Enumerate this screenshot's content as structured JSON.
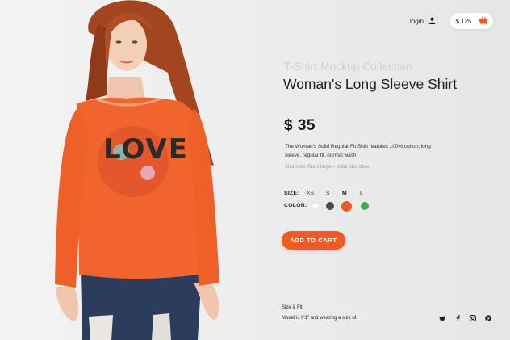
{
  "header": {
    "login_label": "login",
    "user_icon": "user-icon",
    "cart_total": "$ 125",
    "cart_icon": "basket-icon"
  },
  "product": {
    "collection": "T-Shirt Mockup Collection",
    "name": "Woman's Long Sleeve Shirt",
    "price": "$ 35",
    "description": "The Woman's Solid Regular Fit Shirt features 100% cotton, long sleeve, regular fit, normal wash.",
    "size_note": "Size note: Runs large – order size down",
    "shirt_print": "LOVE"
  },
  "options": {
    "size_label": "SIZE:",
    "sizes": [
      "XS",
      "S",
      "M",
      "L"
    ],
    "selected_size": "M",
    "color_label": "COLOR:",
    "colors": [
      "#ffffff",
      "#4a4a4a",
      "#f05a24",
      "#3fae49"
    ],
    "selected_color": "#f05a24"
  },
  "cta": {
    "label": "ADD TO CART",
    "color": "#f05a24"
  },
  "fit": {
    "title": "Size & Fit",
    "text": "Model is 6'1\" and wearing a size M."
  },
  "social": [
    "twitter-icon",
    "facebook-icon",
    "instagram-icon",
    "pinterest-icon"
  ],
  "theme": {
    "accent": "#f05a24",
    "cart_icon_color": "#f05a24"
  }
}
